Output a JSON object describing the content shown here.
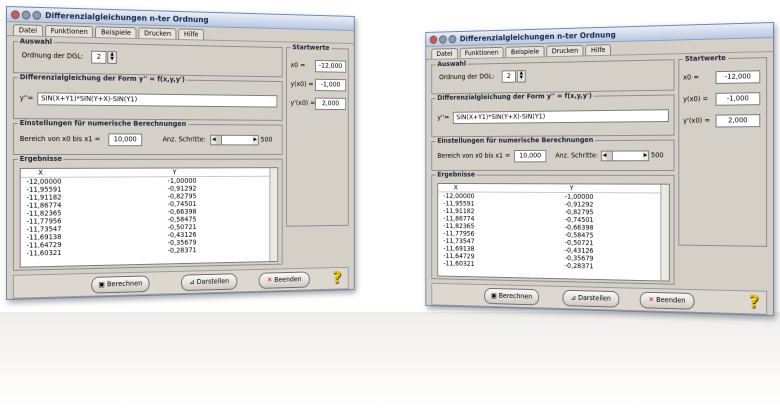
{
  "app": {
    "title": "Differenzialgleichungen n-ter Ordnung"
  },
  "tabs": [
    {
      "label": "Datei"
    },
    {
      "label": "Funktionen"
    },
    {
      "label": "Beispiele"
    },
    {
      "label": "Drucken"
    },
    {
      "label": "Hilfe"
    }
  ],
  "auswahl": {
    "title": "Auswahl",
    "order_label": "Ordnung der DGL:",
    "order_value": "2"
  },
  "dgl": {
    "title": "Differenzialgleichung der Form y'' = f(x,y,y')",
    "prefix": "y''=",
    "value": "SIN(X+Y1)*SIN(Y+X)-SIN(Y1)"
  },
  "startwerte": {
    "title": "Startwerte",
    "x0_label": "x0 =",
    "x0_value": "-12,000",
    "y0_label": "y(x0) =",
    "y0_value": "-1,000",
    "yp0_label": "y'(x0) =",
    "yp0_value": "2,000"
  },
  "einstellungen": {
    "title": "Einstellungen für numerische Berechnungen",
    "range_label": "Bereich von x0 bis x1 =",
    "range_value": "10,000",
    "steps_label": "Anz. Schritte:",
    "steps_value": "500"
  },
  "ergebnisse": {
    "title": "Ergebnisse",
    "col_x": "X",
    "col_y": "Y",
    "rows": [
      [
        "-12,00000",
        "-1,00000"
      ],
      [
        "-11,95591",
        "-0,91292"
      ],
      [
        "-11,91182",
        "-0,82795"
      ],
      [
        "-11,86774",
        "-0,74501"
      ],
      [
        "-11,82365",
        "-0,66398"
      ],
      [
        "-11,77956",
        "-0,58475"
      ],
      [
        "-11,73547",
        "-0,50721"
      ],
      [
        "-11,69138",
        "-0,43126"
      ],
      [
        "-11,64729",
        "-0,35679"
      ],
      [
        "-11,60321",
        "-0,28371"
      ]
    ]
  },
  "buttons": {
    "berechnen": "Berechnen",
    "darstellen": "Darstellen",
    "beenden": "Beenden"
  }
}
